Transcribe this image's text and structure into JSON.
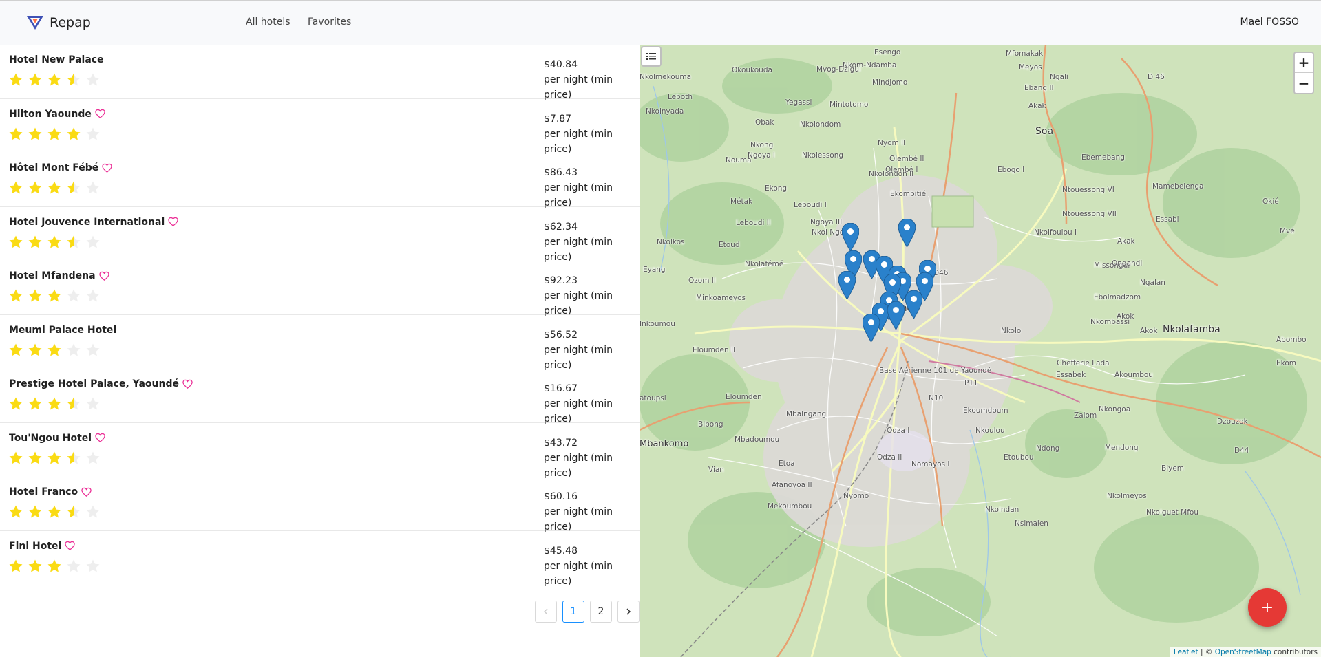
{
  "header": {
    "brand": "Repap",
    "nav": [
      "All hotels",
      "Favorites"
    ],
    "user": "Mael FOSSO"
  },
  "colors": {
    "star": "#fadb14",
    "star_empty": "#eeeeee",
    "heart": "#eb2f96",
    "accent": "#1890ff",
    "fab": "#e53935",
    "marker": "#2a81cb"
  },
  "hotels": [
    {
      "name": "Hotel New Palace",
      "favorite": false,
      "rating": 3.5,
      "price": "$40.84",
      "price_note": "per night (min price)"
    },
    {
      "name": "Hilton Yaounde",
      "favorite": true,
      "rating": 4,
      "price": "$7.87",
      "price_note": "per night (min price)"
    },
    {
      "name": "Hôtel Mont Fébé",
      "favorite": true,
      "rating": 3.5,
      "price": "$86.43",
      "price_note": "per night (min price)"
    },
    {
      "name": "Hotel Jouvence International",
      "favorite": true,
      "rating": 3.5,
      "price": "$62.34",
      "price_note": "per night (min price)"
    },
    {
      "name": "Hotel Mfandena",
      "favorite": true,
      "rating": 3,
      "price": "$92.23",
      "price_note": "per night (min price)"
    },
    {
      "name": "Meumi Palace Hotel",
      "favorite": false,
      "rating": 3,
      "price": "$56.52",
      "price_note": "per night (min price)"
    },
    {
      "name": "Prestige Hotel Palace, Yaoundé",
      "favorite": true,
      "rating": 3.5,
      "price": "$16.67",
      "price_note": "per night (min price)"
    },
    {
      "name": "Tou'Ngou Hotel",
      "favorite": true,
      "rating": 3.5,
      "price": "$43.72",
      "price_note": "per night (min price)"
    },
    {
      "name": "Hotel Franco",
      "favorite": true,
      "rating": 3.5,
      "price": "$60.16",
      "price_note": "per night (min price)"
    },
    {
      "name": "Fini Hotel",
      "favorite": true,
      "rating": 3,
      "price": "$45.48",
      "price_note": "per night (min price)"
    }
  ],
  "pagination": {
    "prev": "<",
    "pages": [
      "1",
      "2"
    ],
    "current": "1",
    "next": ">"
  },
  "map": {
    "labels": [
      "Esengo",
      "Mfomakak",
      "Meyos",
      "Nkom-Ndamba",
      "Mvog-Dzigui",
      "D 46",
      "Ngali",
      "Nkolmekouma",
      "Okoukouda",
      "Mindjomo",
      "Ebang II",
      "Leboth",
      "Yegassi",
      "Mintotomo",
      "Akak",
      "Nkolnyada",
      "Obak",
      "Nkolondom",
      "Soa",
      "Nyom II",
      "Nkong",
      "Ngoya I",
      "Nkolessong",
      "Olembé II",
      "Ebemebang",
      "Mamebelenga",
      "Nouma",
      "Olembé I",
      "Ebogo I",
      "Nkolondon II",
      "Ekong",
      "Ekombitié",
      "Ntouessong VI",
      "Métak",
      "Leboudi I",
      "Ntouessong VII",
      "Leboudi II",
      "Ngoya III",
      "Nkol Ngon",
      "Nkolfoulou I",
      "Essabi",
      "Mvé",
      "Okié",
      "Nkolkos",
      "Etoud",
      "Akak",
      "Missongui",
      "Ongandi",
      "Nkolafémé",
      "D46",
      "Eyang",
      "Ozom II",
      "Ngalan",
      "Minkoameyos",
      "Ebolmadzom",
      "Inkoumou",
      "Yaoundé",
      "Nkombassi",
      "Akok",
      "Nkolo",
      "Akok",
      "Nkolafamba",
      "Eloumden II",
      "Abombo",
      "Base Aérienne 101 de Yaoundé",
      "Chefferie Lada",
      "Ekom",
      "Essabek",
      "Akoumbou",
      "P11",
      "Eloumden",
      "N10",
      "atoupsi",
      "Mbalngang",
      "Ekoumdoum",
      "Nkongoa",
      "Bibong",
      "Zalom",
      "Dzouzok",
      "Mbadoumou",
      "Odza I",
      "Nkoulou",
      "Mbankomo",
      "Mendong",
      "Ndong",
      "D44",
      "Odza II",
      "Etoubou",
      "Etoa",
      "Nomayos I",
      "Vian",
      "Biyem",
      "Afanoyoa II",
      "Nyomo",
      "Nkolmeyos",
      "Mekoumbou",
      "Nkolndan",
      "Nkolguet Mfou",
      "Nsimalen"
    ],
    "zoom_in": "+",
    "zoom_out": "−",
    "fab": "+",
    "attribution": {
      "leaflet": "Leaflet",
      "sep": " | © ",
      "osm": "OpenStreetMap",
      "suffix": " contributors"
    }
  }
}
